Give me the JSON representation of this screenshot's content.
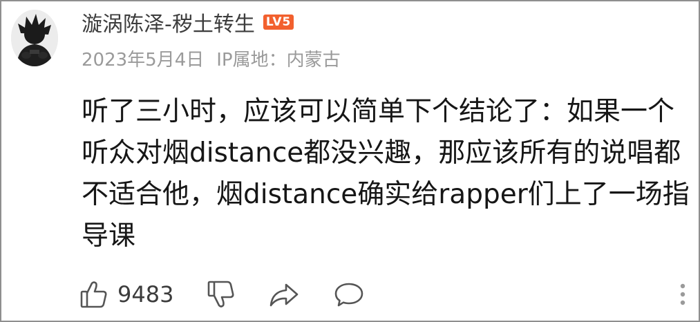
{
  "comment": {
    "username": "漩涡陈泽-秽土转生",
    "level_badge": "LV5",
    "date": "2023年5月4日",
    "ip_location": "IP属地：内蒙古",
    "text": "听了三小时，应该可以简单下个结论了：如果一个听众对烟distance都没兴趣，那应该所有的说唱都不适合他，烟distance确实给rapper们上了一场指导课",
    "like_count": "9483"
  },
  "icons": {
    "like": "thumbs-up-icon",
    "dislike": "thumbs-down-icon",
    "share": "share-arrow-icon",
    "reply": "comment-bubble-icon",
    "more": "more-vertical-icon"
  },
  "colors": {
    "badge": "#f2602e",
    "meta_text": "#9a9a9a",
    "username_text": "#3c3c3c",
    "icon_stroke": "#555555"
  }
}
